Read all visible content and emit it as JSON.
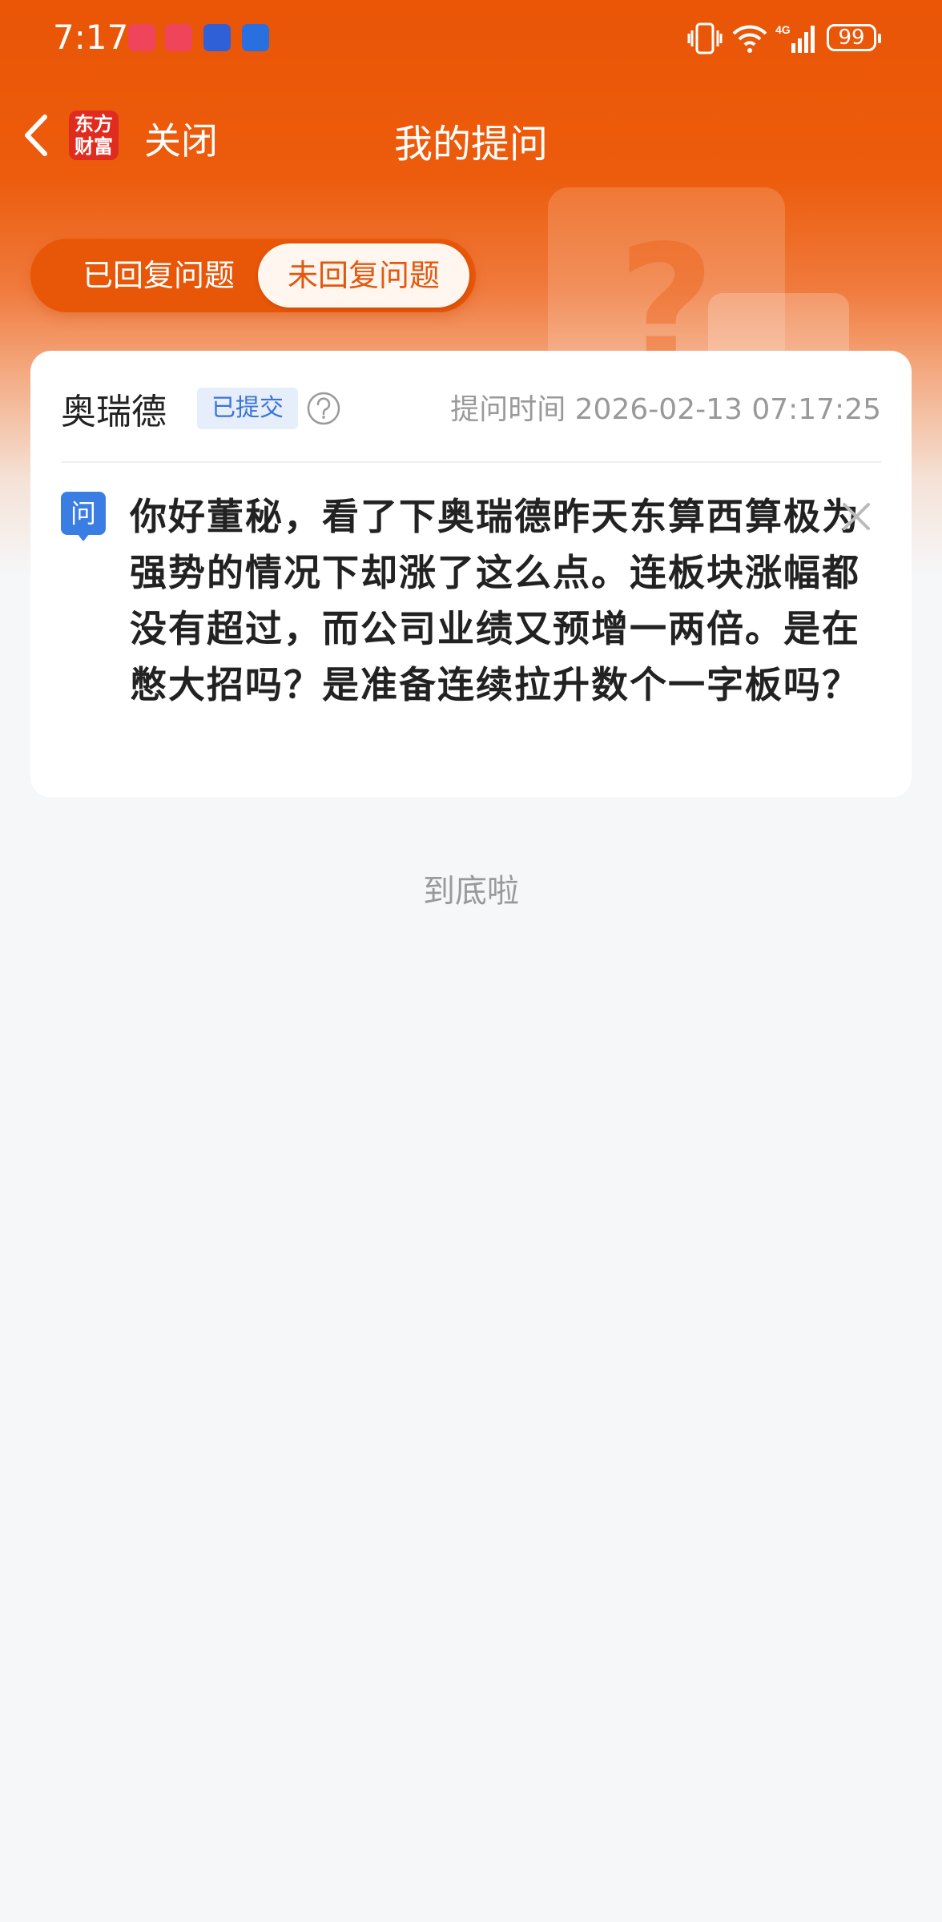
{
  "status_bar": {
    "time": "7:17",
    "battery": "99",
    "network": "4G"
  },
  "nav": {
    "close_label": "关闭",
    "title": "我的提问",
    "logo_line1": "东方",
    "logo_line2": "财富"
  },
  "tabs": [
    {
      "label": "已回复问题",
      "active": false
    },
    {
      "label": "未回复问题",
      "active": true
    }
  ],
  "question_card": {
    "company": "奥瑞德",
    "status": "已提交",
    "time_label": "提问时间",
    "time_value": "2026-02-13 07:17:25",
    "question_badge": "问",
    "question_text": "你好董秘，看了下奥瑞德昨天东算西算极为强势的情况下却涨了这么点。连板块涨幅都没有超过，而公司业绩又预增一两倍。是在憋大招吗？是准备连续拉升数个一字板吗？"
  },
  "footer": {
    "end_text": "到底啦"
  },
  "colors": {
    "brand_orange": "#ea5506",
    "tab_active_text": "#e2580f",
    "badge_blue": "#3a73d8",
    "question_icon_blue": "#3a7ee4"
  },
  "icons": [
    "back-arrow-icon",
    "help-icon",
    "question-icon",
    "close-icon",
    "vibrate-icon",
    "wifi-icon",
    "signal-icon",
    "battery-icon"
  ]
}
